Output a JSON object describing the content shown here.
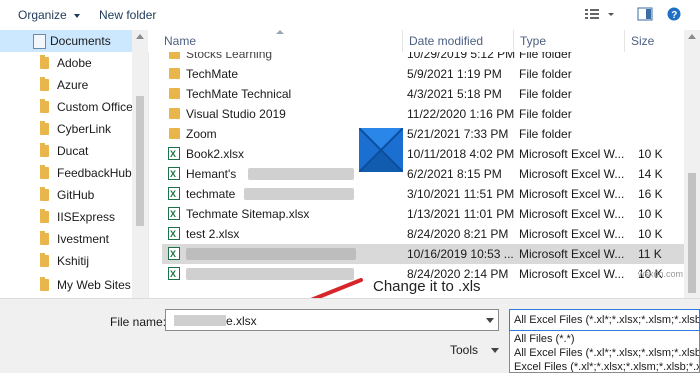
{
  "toolbar": {
    "organize": "Organize",
    "new_folder": "New folder"
  },
  "nav": {
    "items": [
      {
        "label": "Documents",
        "selected": true
      },
      {
        "label": "Adobe"
      },
      {
        "label": "Azure"
      },
      {
        "label": "Custom Office"
      },
      {
        "label": "CyberLink"
      },
      {
        "label": "Ducat"
      },
      {
        "label": "FeedbackHub"
      },
      {
        "label": "GitHub"
      },
      {
        "label": "IISExpress"
      },
      {
        "label": "Ivestment"
      },
      {
        "label": "Kshitij"
      },
      {
        "label": "My Web Sites"
      }
    ]
  },
  "columns": {
    "name": "Name",
    "date": "Date modified",
    "type": "Type",
    "size": "Size"
  },
  "files": [
    {
      "name": "Stocks Learning",
      "date": "10/29/2019 5:12 PM",
      "type": "File folder",
      "size": "",
      "icon": "folder"
    },
    {
      "name": "TechMate",
      "date": "5/9/2021 1:19 PM",
      "type": "File folder",
      "size": "",
      "icon": "folder"
    },
    {
      "name": "TechMate Technical",
      "date": "4/3/2021 5:18 PM",
      "type": "File folder",
      "size": "",
      "icon": "folder"
    },
    {
      "name": "Visual Studio 2019",
      "date": "11/22/2020 1:16 PM",
      "type": "File folder",
      "size": "",
      "icon": "folder"
    },
    {
      "name": "Zoom",
      "date": "5/21/2021 7:33 PM",
      "type": "File folder",
      "size": "",
      "icon": "folder"
    },
    {
      "name": "Book2.xlsx",
      "date": "10/11/2018 4:02 PM",
      "type": "Microsoft Excel W...",
      "size": "10 K",
      "icon": "excel"
    },
    {
      "name": "Hemant's",
      "date": "6/2/2021 8:15 PM",
      "type": "Microsoft Excel W...",
      "size": "14 K",
      "icon": "excel"
    },
    {
      "name": "techmate",
      "date": "3/10/2021 11:51 PM",
      "type": "Microsoft Excel W...",
      "size": "16 K",
      "icon": "excel"
    },
    {
      "name": "Techmate Sitemap.xlsx",
      "date": "1/13/2021 11:01 PM",
      "type": "Microsoft Excel W...",
      "size": "10 K",
      "icon": "excel"
    },
    {
      "name": "test 2.xlsx",
      "date": "8/24/2020 8:21 PM",
      "type": "Microsoft Excel W...",
      "size": "10 K",
      "icon": "excel"
    },
    {
      "name": "",
      "date": "10/16/2019 10:53 ...",
      "type": "Microsoft Excel W...",
      "size": "11 K",
      "icon": "excel",
      "selected": true
    },
    {
      "name": "",
      "date": "8/24/2020 2:14 PM",
      "type": "Microsoft Excel W...",
      "size": "10 K",
      "icon": "excel"
    }
  ],
  "bottom": {
    "file_name_label": "File name:",
    "file_name_value": "e.xlsx",
    "file_type_value": "All Excel Files (*.xl*;*.xlsx;*.xlsm;*.xlsb;*.",
    "type_options": [
      "All Files (*.*)",
      "All Excel Files (*.xl*;*.xlsx;*.xlsm;*.xlsb;*.",
      "Excel Files (*.xl*;*.xlsx;*.xlsm;*.xlsb;*.xlam;*.x"
    ],
    "tools": "Tools"
  },
  "annotation": {
    "text": "Change it to .xls",
    "color": "#d7262b"
  },
  "watermark": "wsxdn.com"
}
